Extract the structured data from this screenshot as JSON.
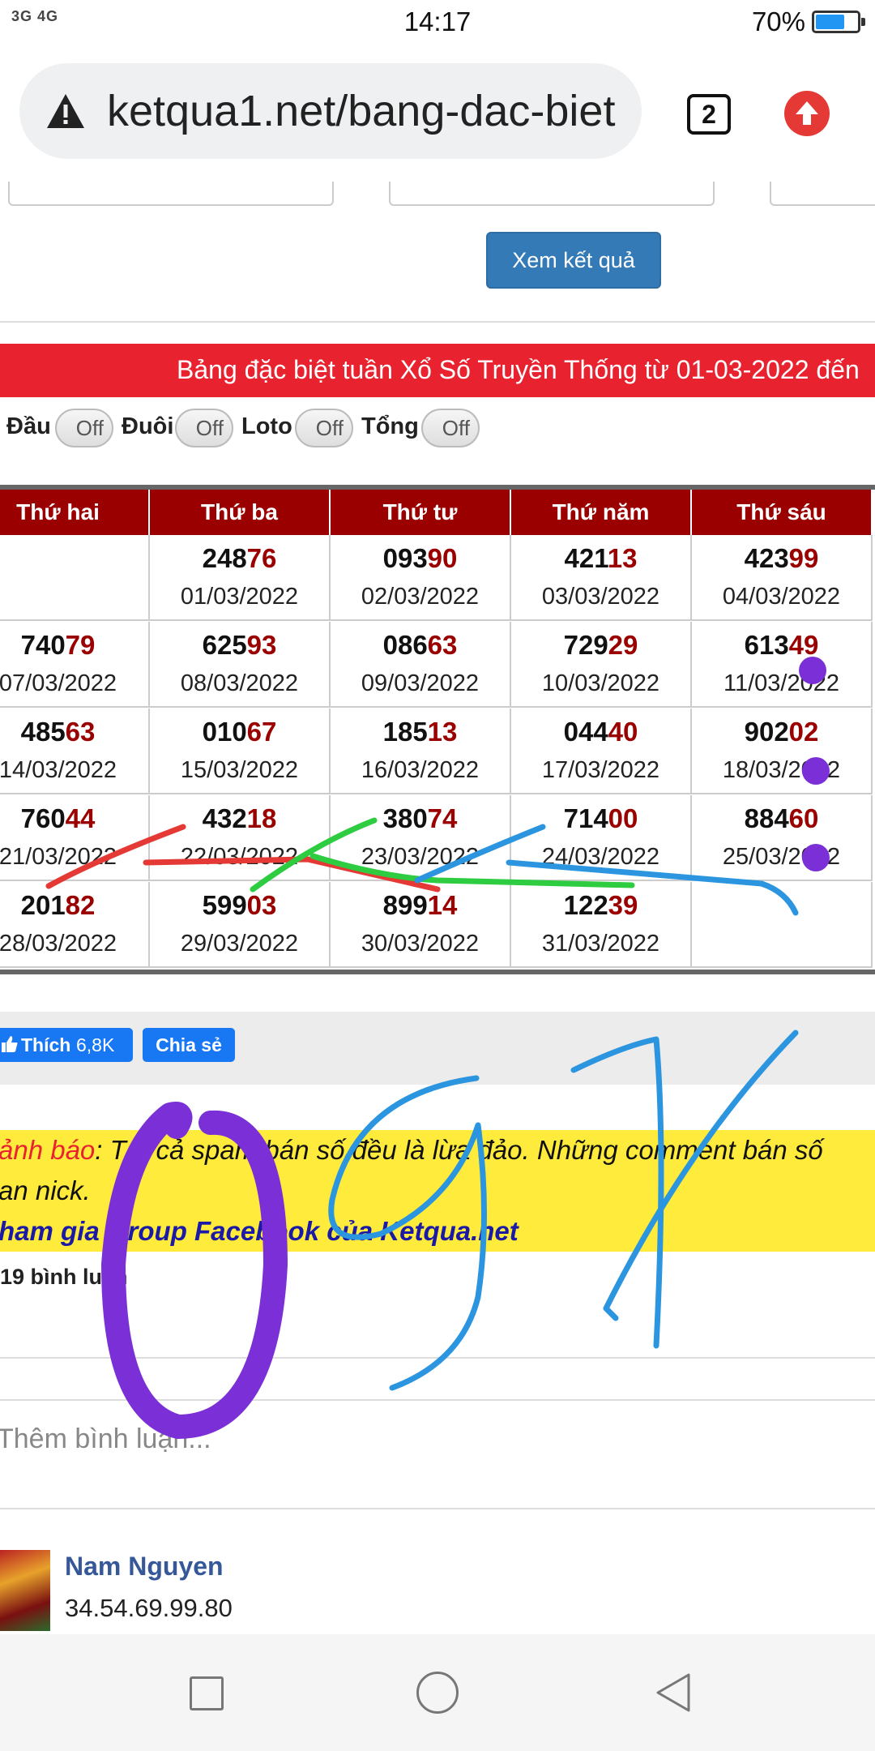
{
  "status_bar": {
    "signal": "3G 4G",
    "time": "14:17",
    "battery_percent": "70%",
    "battery_level": 0.7
  },
  "browser": {
    "url": "ketqua1.net/bang-dac-biet",
    "tab_count": "2"
  },
  "form": {
    "view_results_button": "Xem kết quả"
  },
  "banner": {
    "title": "Bảng đặc biệt tuần Xổ Số Truyền Thống từ 01-03-2022 đến"
  },
  "toggles": [
    {
      "label": "Đầu",
      "state": "Off"
    },
    {
      "label": "Đuôi",
      "state": "Off"
    },
    {
      "label": "Loto",
      "state": "Off"
    },
    {
      "label": "Tổng",
      "state": "Off"
    }
  ],
  "table": {
    "headers": [
      "Thứ hai",
      "Thứ ba",
      "Thứ tư",
      "Thứ năm",
      "Thứ sáu"
    ],
    "rows": [
      [
        null,
        {
          "head": "248",
          "tail": "76",
          "date": "01/03/2022"
        },
        {
          "head": "093",
          "tail": "90",
          "date": "02/03/2022"
        },
        {
          "head": "421",
          "tail": "13",
          "date": "03/03/2022"
        },
        {
          "head": "423",
          "tail": "99",
          "date": "04/03/2022"
        }
      ],
      [
        {
          "head": "740",
          "tail": "79",
          "date": "07/03/2022"
        },
        {
          "head": "625",
          "tail": "93",
          "date": "08/03/2022"
        },
        {
          "head": "086",
          "tail": "63",
          "date": "09/03/2022"
        },
        {
          "head": "729",
          "tail": "29",
          "date": "10/03/2022"
        },
        {
          "head": "613",
          "tail": "49",
          "date": "11/03/2022"
        }
      ],
      [
        {
          "head": "485",
          "tail": "63",
          "date": "14/03/2022"
        },
        {
          "head": "010",
          "tail": "67",
          "date": "15/03/2022"
        },
        {
          "head": "185",
          "tail": "13",
          "date": "16/03/2022"
        },
        {
          "head": "044",
          "tail": "40",
          "date": "17/03/2022"
        },
        {
          "head": "902",
          "tail": "02",
          "date": "18/03/2022"
        }
      ],
      [
        {
          "head": "760",
          "tail": "44",
          "date": "21/03/2022"
        },
        {
          "head": "432",
          "tail": "18",
          "date": "22/03/2022"
        },
        {
          "head": "380",
          "tail": "74",
          "date": "23/03/2022"
        },
        {
          "head": "714",
          "tail": "00",
          "date": "24/03/2022"
        },
        {
          "head": "884",
          "tail": "60",
          "date": "25/03/2022"
        }
      ],
      [
        {
          "head": "201",
          "tail": "82",
          "date": "28/03/2022"
        },
        {
          "head": "599",
          "tail": "03",
          "date": "29/03/2022"
        },
        {
          "head": "899",
          "tail": "14",
          "date": "30/03/2022"
        },
        {
          "head": "122",
          "tail": "39",
          "date": "31/03/2022"
        },
        null
      ]
    ]
  },
  "social": {
    "like_label": "Thích",
    "like_count": "6,8K",
    "share_label": "Chia sẻ"
  },
  "warning": {
    "prefix": "ảnh báo",
    "text": ": Tất cả spam bán số đều là lừa đảo. Những comment bán số",
    "text_line2": "an nick.",
    "group_link": "ham gia Group Facebook của Ketqua.net"
  },
  "comments": {
    "count_label": "19 bình luận",
    "input_placeholder": "Thêm bình luận...",
    "items": [
      {
        "author": "Nam Nguyen",
        "text": "34.54.69.99.80"
      }
    ]
  },
  "colors": {
    "header_red": "#9a0000",
    "banner_red": "#e8232f",
    "button_blue": "#337ab7",
    "facebook_blue": "#1877f2",
    "warning_yellow": "#ffeb3b"
  },
  "icons": [
    "warning-triangle-icon",
    "tabs-icon",
    "upload-icon",
    "thumbs-up-icon",
    "square-nav-icon",
    "home-circle-icon",
    "back-triangle-icon"
  ]
}
